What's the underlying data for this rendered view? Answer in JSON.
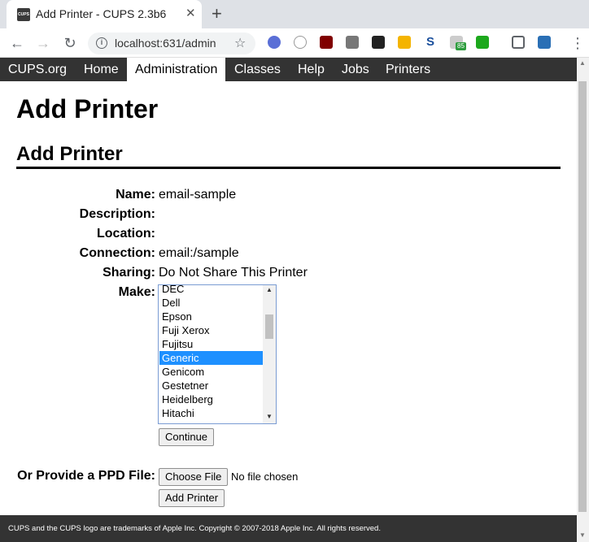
{
  "browser": {
    "tab_title": "Add Printer - CUPS 2.3b6",
    "favicon_text": "CUPS",
    "url": "localhost:631/admin",
    "extension_badge": "85"
  },
  "nav": {
    "items": [
      "CUPS.org",
      "Home",
      "Administration",
      "Classes",
      "Help",
      "Jobs",
      "Printers"
    ],
    "active": "Administration"
  },
  "page": {
    "title": "Add Printer",
    "section_title": "Add Printer"
  },
  "form": {
    "name_label": "Name:",
    "name_value": "email-sample",
    "description_label": "Description:",
    "description_value": "",
    "location_label": "Location:",
    "location_value": "",
    "connection_label": "Connection:",
    "connection_value": "email:/sample",
    "sharing_label": "Sharing:",
    "sharing_value": "Do Not Share This Printer",
    "make_label": "Make:",
    "make_options": [
      "DEC",
      "Dell",
      "Epson",
      "Fuji Xerox",
      "Fujitsu",
      "Generic",
      "Genicom",
      "Gestetner",
      "Heidelberg",
      "Hitachi"
    ],
    "make_selected": "Generic",
    "continue_label": "Continue",
    "ppd_label": "Or Provide a PPD File:",
    "choose_file_label": "Choose File",
    "no_file_text": "No file chosen",
    "add_printer_label": "Add Printer"
  },
  "footer": {
    "text": "CUPS and the CUPS logo are trademarks of Apple Inc. Copyright © 2007-2018 Apple Inc. All rights reserved."
  }
}
